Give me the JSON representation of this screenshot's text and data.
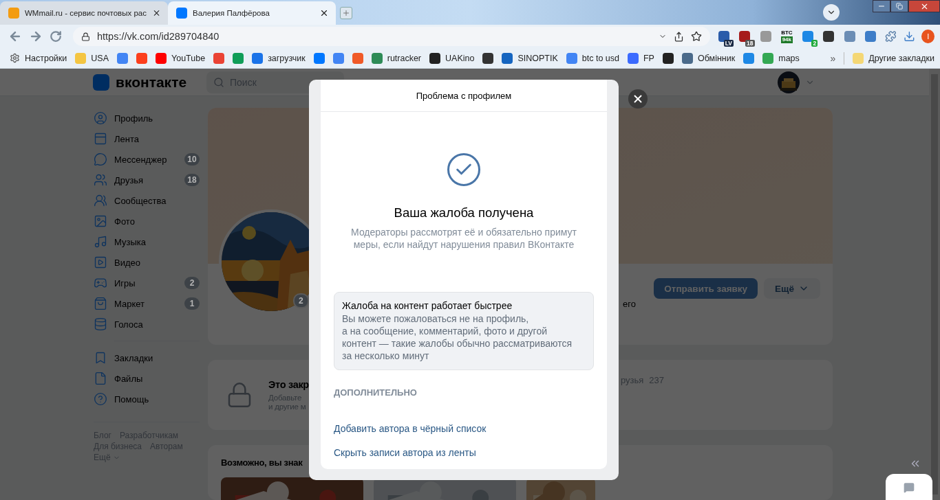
{
  "browser": {
    "tabs": [
      {
        "title": "WMmail.ru - сервис почтовых рас",
        "selected": false
      },
      {
        "title": "Валерия Палфёрова",
        "selected": true
      }
    ],
    "address": "https://vk.com/id289704840",
    "extensions": [
      {
        "kind": "badged",
        "badge": "LV"
      },
      {
        "kind": "badged",
        "badge": "18"
      },
      {
        "kind": "plain"
      },
      {
        "kind": "ticker",
        "label": "BTC",
        "badge": "94k"
      },
      {
        "kind": "badged",
        "badge": "2"
      },
      {
        "kind": "plain"
      },
      {
        "kind": "plain"
      },
      {
        "kind": "plain"
      }
    ],
    "profile_initial": "I",
    "bookmarks": [
      {
        "kind": "link",
        "label": "Настройки"
      },
      {
        "kind": "link",
        "label": "USA"
      },
      {
        "kind": "icon"
      },
      {
        "kind": "icon"
      },
      {
        "kind": "link",
        "label": "YouTube"
      },
      {
        "kind": "icon"
      },
      {
        "kind": "icon"
      },
      {
        "kind": "link",
        "label": "загрузчик"
      },
      {
        "kind": "icon"
      },
      {
        "kind": "icon"
      },
      {
        "kind": "icon"
      },
      {
        "kind": "link",
        "label": "rutracker"
      },
      {
        "kind": "link",
        "label": "UAKino"
      },
      {
        "kind": "icon"
      },
      {
        "kind": "link",
        "label": "SINOPTIK"
      },
      {
        "kind": "link",
        "label": "btc to usd"
      },
      {
        "kind": "link",
        "label": "FP"
      },
      {
        "kind": "icon"
      },
      {
        "kind": "link",
        "label": "Обмінник"
      },
      {
        "kind": "icon"
      },
      {
        "kind": "link",
        "label": "maps"
      }
    ],
    "bookmarks_more": "»",
    "other_bookmarks": "Другие закладки"
  },
  "vk": {
    "logo": "вконтакте",
    "search": {
      "placeholder": "Поиск"
    },
    "menu": [
      {
        "label": "Профиль"
      },
      {
        "label": "Лента"
      },
      {
        "label": "Мессенджер",
        "count": "10"
      },
      {
        "label": "Друзья",
        "count": "18"
      },
      {
        "label": "Сообщества"
      },
      {
        "label": "Фото"
      },
      {
        "label": "Музыка"
      },
      {
        "label": "Видео"
      },
      {
        "label": "Игры",
        "count": "2"
      },
      {
        "label": "Маркет",
        "count": "1"
      },
      {
        "label": "Голоса"
      }
    ],
    "menu_secondary": [
      {
        "label": "Закладки"
      },
      {
        "label": "Файлы"
      },
      {
        "label": "Помощь"
      }
    ],
    "footer_links": [
      "Блог",
      "Разработчикам",
      "Для бизнеса",
      "Авторам",
      "Ещё"
    ],
    "profile": {
      "avatar_badge": "2",
      "send_request": "Отправить заявку",
      "more": "Ещё",
      "status_fragment": "его"
    },
    "closed_card": {
      "title": "Это закр",
      "text_lines": [
        "Добавьте",
        "и другие м"
      ],
      "friends_label": "рузья",
      "friends_count": "237"
    },
    "suggestions": {
      "title": "Возможно, вы знак"
    }
  },
  "modal": {
    "title": "Проблема с профилем",
    "heading": "Ваша жалоба получена",
    "text": "Модераторы рассмотрят её и обязательно примут меры, если найдут нарушения правил ВКонтакте",
    "tip": {
      "title": "Жалоба на контент работает быстрее",
      "lines": [
        "Вы можете пожаловаться не на профиль,",
        "а на сообщение, комментарий, фото и другой",
        "контент — такие жалобы обычно рассматриваются",
        "за несколько минут"
      ]
    },
    "section": "ДОПОЛНИТЕЛЬНО",
    "links": [
      "Добавить автора в чёрный список",
      "Скрыть записи автора из ленты"
    ]
  }
}
